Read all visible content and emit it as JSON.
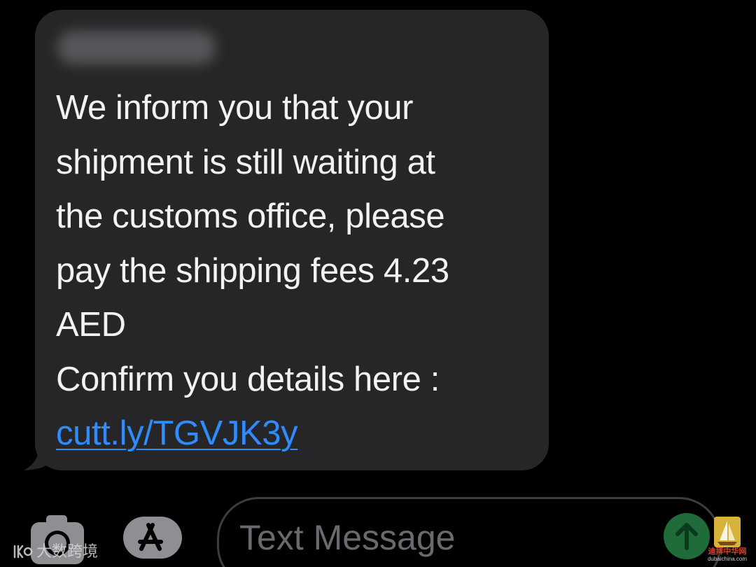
{
  "conversation": {
    "message": {
      "lines": [
        "We inform you that your",
        "shipment is still waiting at",
        "the customs office, please",
        "pay the shipping fees 4.23",
        "AED",
        "Confirm you details here :"
      ],
      "link": "cutt.ly/TGVJK3y"
    }
  },
  "composer": {
    "placeholder": "Text Message",
    "camera_icon": "camera-icon",
    "apps_icon": "app-store-icon",
    "send_icon": "arrow-up-icon"
  },
  "watermarks": {
    "left_text": "大数跨境",
    "right_name": "迪拜中华网",
    "right_url": "dubaichina.com"
  },
  "colors": {
    "background": "#000000",
    "bubble": "#262628",
    "text": "#f2f2f2",
    "link": "#2f8cff",
    "placeholder": "#6a6a6e",
    "send_button": "#1f6b3a"
  }
}
